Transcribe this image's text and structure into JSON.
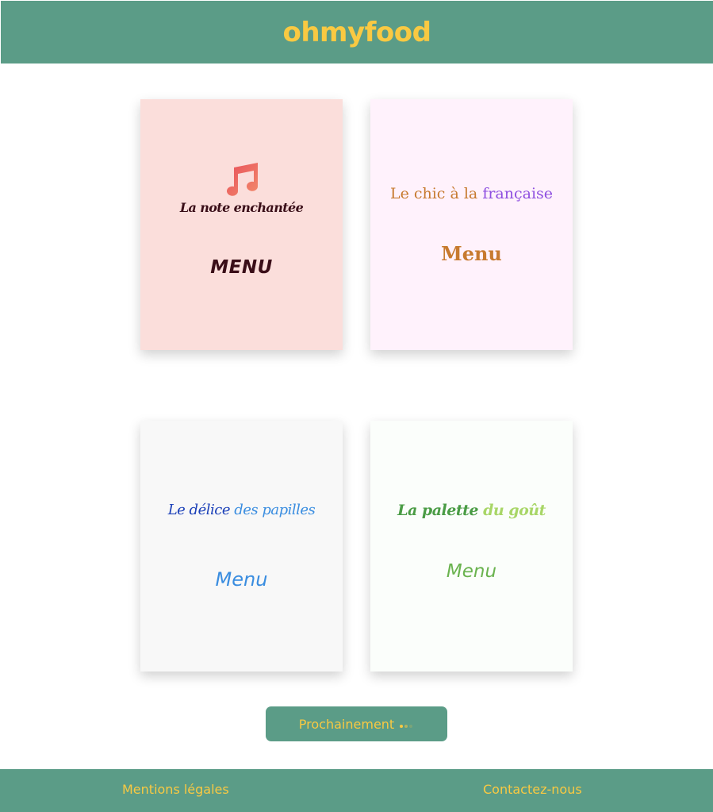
{
  "header": {
    "logo": "ohmyfood"
  },
  "restaurants": [
    {
      "title": "La note enchantée",
      "menu_label": "MENU",
      "icon": "music-note-icon"
    },
    {
      "title_part1": "Le chic à la",
      "title_part2": "française",
      "menu_label": "Menu"
    },
    {
      "title_part1": "Le délice",
      "title_part2": "des papilles",
      "menu_label": "Menu"
    },
    {
      "title_part1": "La palette",
      "title_part2": "du goût",
      "menu_label": "Menu"
    }
  ],
  "coming_soon": {
    "label": "Prochainement"
  },
  "footer": {
    "legal": "Mentions légales",
    "contact": "Contactez-nous"
  },
  "colors": {
    "header_bg": "#5b9c87",
    "logo": "#f9c942",
    "card1_bg": "#fbdedb",
    "card2_bg": "#fff2fc",
    "card3_bg": "#f8f8f8",
    "card4_bg": "#fbfefb"
  }
}
